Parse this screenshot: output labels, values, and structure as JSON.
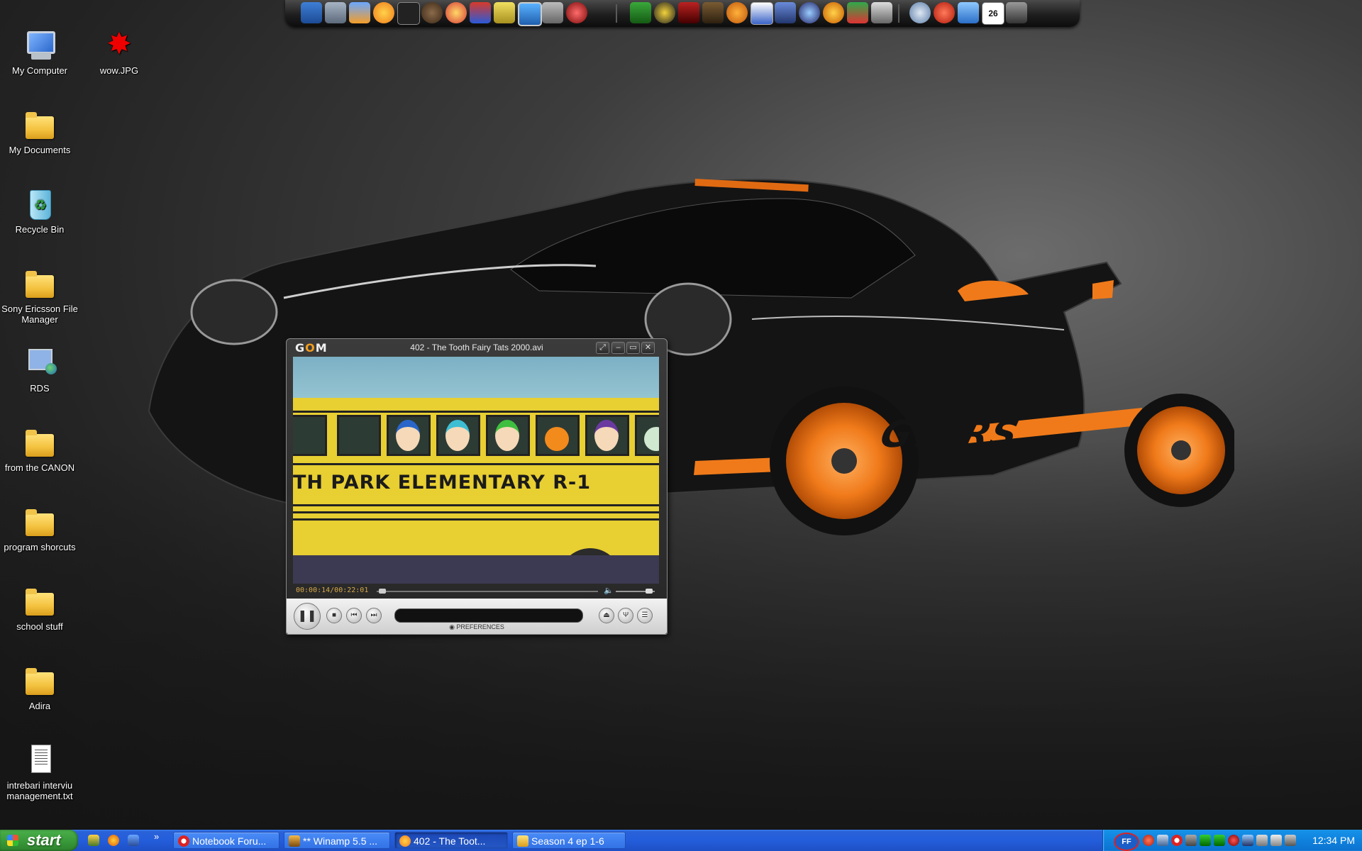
{
  "desktop_icons": [
    {
      "label": "My Computer",
      "icon": "computer-icon"
    },
    {
      "label": "wow.JPG",
      "icon": "image-file-icon"
    },
    {
      "label": "My Documents",
      "icon": "folder-icon"
    },
    {
      "label": "Recycle Bin",
      "icon": "recycle-bin-icon"
    },
    {
      "label": "Sony Ericsson File Manager",
      "icon": "phone-folder-icon"
    },
    {
      "label": "RDS",
      "icon": "network-shortcut-icon"
    },
    {
      "label": "from the CANON",
      "icon": "folder-icon"
    },
    {
      "label": "program shorcuts",
      "icon": "folder-icon"
    },
    {
      "label": "school stuff",
      "icon": "folder-icon"
    },
    {
      "label": "Adira",
      "icon": "folder-icon"
    },
    {
      "label": "intrebari interviu management.txt",
      "icon": "text-file-icon"
    }
  ],
  "player": {
    "logo_text": "G",
    "logo_accent": "O",
    "logo_tail": "M",
    "title": "402 - The Tooth Fairy Tats 2000.avi",
    "time": "00:00:14/00:22:01",
    "preferences_label": "PREFERENCES",
    "video_caption": "TH PARK ELEMENTARY R-1",
    "progress": 0.011,
    "volume": 0.85
  },
  "taskbar": {
    "start_label": "start",
    "tasks": [
      {
        "label": "Notebook Foru...",
        "icon": "opera-icon",
        "active": false
      },
      {
        "label": "** Winamp 5.5 ...",
        "icon": "winamp-icon",
        "active": false
      },
      {
        "label": "402 - The Toot...",
        "icon": "gom-player-icon",
        "active": true
      },
      {
        "label": "Season 4 ep 1-6",
        "icon": "folder-icon",
        "active": false
      }
    ],
    "tray_badge": "FF",
    "clock": "12:34 PM"
  },
  "colors": {
    "accent": "#f07a1a",
    "taskbar": "#245ddb",
    "start": "#3a9b3a"
  }
}
